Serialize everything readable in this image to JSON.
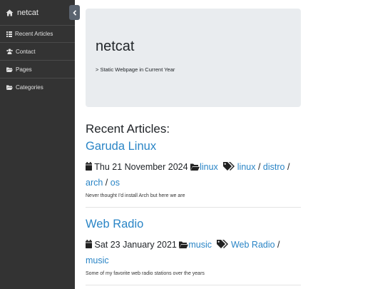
{
  "sidebar": {
    "brand": "netcat",
    "items": [
      {
        "label": "Recent Articles",
        "icon": "list-icon"
      },
      {
        "label": "Contact",
        "icon": "users-icon"
      },
      {
        "label": "Pages",
        "icon": "folder-open-icon"
      },
      {
        "label": "Categories",
        "icon": "folder-open-icon"
      }
    ],
    "toggle_icon": "chevron-left-icon"
  },
  "jumbotron": {
    "title": "netcat",
    "subtitle": "> Static Webpage in Current Year"
  },
  "section_title": "Recent Articles:",
  "posts": [
    {
      "title": "Garuda Linux",
      "date": "Thu 21 November 2024",
      "category": "linux",
      "tags": [
        "linux",
        "distro",
        "arch",
        "os"
      ],
      "summary": "Never thought I'd install Arch but here we are"
    },
    {
      "title": "Web Radio",
      "date": "Sat 23 January 2021",
      "category": "music",
      "tags": [
        "Web Radio",
        "music"
      ],
      "summary": "Some of my favorite web radio stations over the years"
    }
  ],
  "colors": {
    "sidebar_bg": "#333333",
    "link": "#2a85c6",
    "jumbotron_bg": "#e9ecef"
  }
}
